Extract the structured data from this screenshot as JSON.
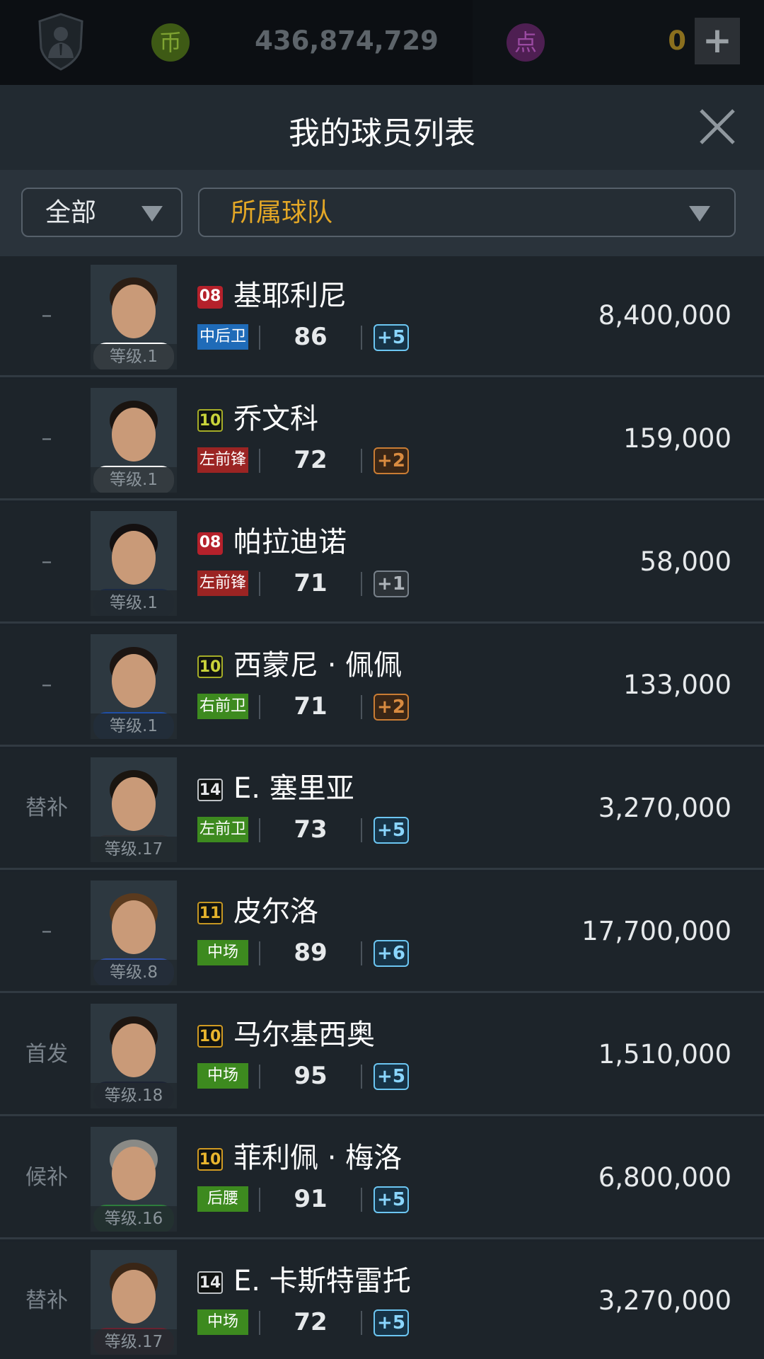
{
  "topbar": {
    "coin_icon": "币",
    "coin_amount": "436,874,729",
    "point_icon": "点",
    "point_amount": "0",
    "plus_label": "+"
  },
  "title": "我的球员列表",
  "filters": {
    "all_label": "全部",
    "team_label": "所属球队"
  },
  "players": [
    {
      "status": "–",
      "level": "等级.1",
      "season": "08",
      "name": "基耶利尼",
      "position": "中后卫",
      "position_color": "blue",
      "ovr": "86",
      "upgrade": "+5",
      "upgrade_color": "cyan",
      "price": "8,400,000"
    },
    {
      "status": "–",
      "level": "等级.1",
      "season": "10",
      "name": "乔文科",
      "position": "左前锋",
      "position_color": "red",
      "ovr": "72",
      "upgrade": "+2",
      "upgrade_color": "orange",
      "price": "159,000"
    },
    {
      "status": "–",
      "level": "等级.1",
      "season": "08",
      "name": "帕拉迪诺",
      "position": "左前锋",
      "position_color": "red",
      "ovr": "71",
      "upgrade": "+1",
      "upgrade_color": "gray",
      "price": "58,000"
    },
    {
      "status": "–",
      "level": "等级.1",
      "season": "10",
      "name": "西蒙尼 · 佩佩",
      "position": "右前卫",
      "position_color": "green",
      "ovr": "71",
      "upgrade": "+2",
      "upgrade_color": "orange",
      "price": "133,000"
    },
    {
      "status": "替补",
      "level": "等级.17",
      "season": "14",
      "name": "E. 塞里亚",
      "position": "左前卫",
      "position_color": "green",
      "ovr": "73",
      "upgrade": "+5",
      "upgrade_color": "cyan",
      "price": "3,270,000"
    },
    {
      "status": "–",
      "level": "等级.8",
      "season": "11",
      "name": "皮尔洛",
      "position": "中场",
      "position_color": "green",
      "ovr": "89",
      "upgrade": "+6",
      "upgrade_color": "cyan",
      "price": "17,700,000"
    },
    {
      "status": "首发",
      "level": "等级.18",
      "season": "10",
      "name": "马尔基西奥",
      "position": "中场",
      "position_color": "green",
      "ovr": "95",
      "upgrade": "+5",
      "upgrade_color": "cyan",
      "price": "1,510,000"
    },
    {
      "status": "候补",
      "level": "等级.16",
      "season": "10",
      "name": "菲利佩 · 梅洛",
      "position": "后腰",
      "position_color": "green",
      "ovr": "91",
      "upgrade": "+5",
      "upgrade_color": "cyan",
      "price": "6,800,000"
    },
    {
      "status": "替补",
      "level": "等级.17",
      "season": "14",
      "name": "E. 卡斯特雷托",
      "position": "中场",
      "position_color": "green",
      "ovr": "72",
      "upgrade": "+5",
      "upgrade_color": "cyan",
      "price": "3,270,000"
    }
  ],
  "colors": {
    "accent_gold": "#e3a726",
    "bg": "#1d242a",
    "pos_blue": "#1f6bb8",
    "pos_red": "#9b2423",
    "pos_green": "#3d8a1f"
  },
  "icons": {
    "manager": "manager-shield-icon",
    "close": "close-icon",
    "dropdown": "chevron-down-icon",
    "add": "plus-icon"
  }
}
